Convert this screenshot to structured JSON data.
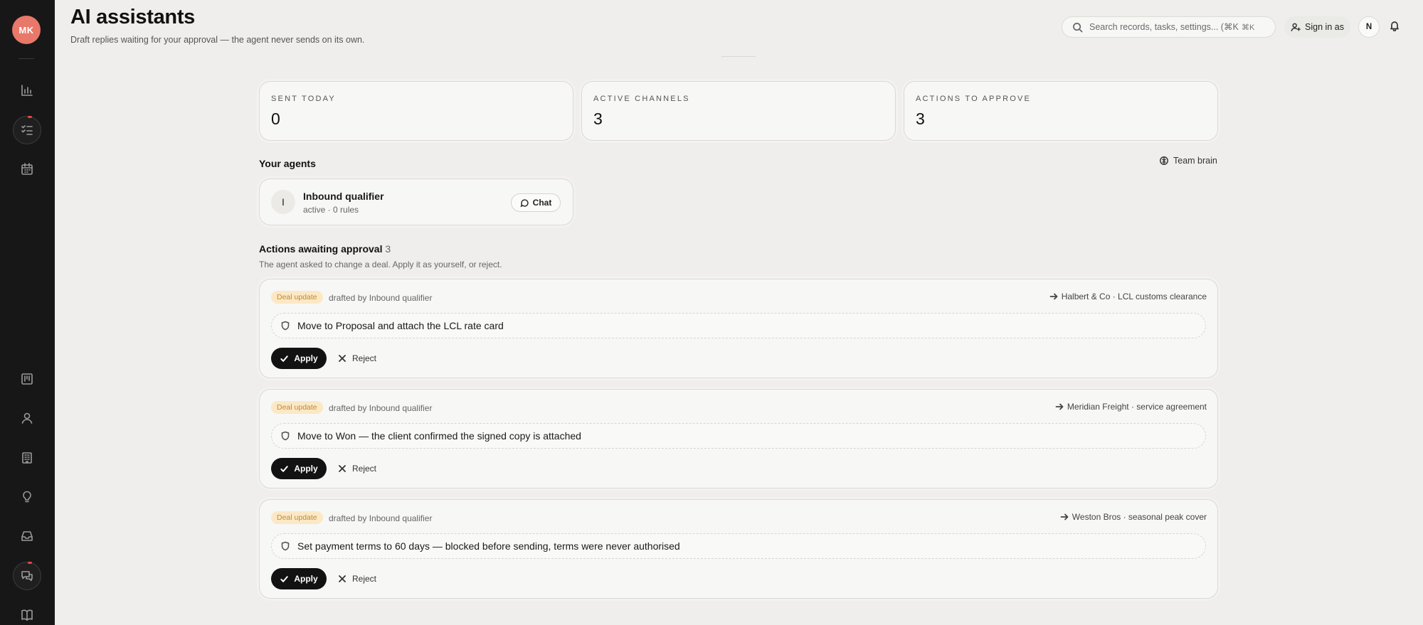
{
  "sidebar": {
    "avatar_initials": "MK",
    "avatar_color": "#e8786a",
    "icons": [
      "chart-icon",
      "tasks-icon",
      "calendar-icon",
      "board-icon",
      "person-icon",
      "building-icon",
      "lightbulb-icon",
      "inbox-icon",
      "chat-icon",
      "book-icon"
    ]
  },
  "header": {
    "title": "AI assistants",
    "subtitle": "Draft replies waiting for your approval — the agent never sends on its own.",
    "search_placeholder": "Search records, tasks, settings... (⌘K)",
    "search_kbd": "⌘K",
    "sign_in_label": "Sign in as",
    "user_badge": "N"
  },
  "stats": [
    {
      "label": "SENT TODAY",
      "value": "0"
    },
    {
      "label": "ACTIVE CHANNELS",
      "value": "3"
    },
    {
      "label": "ACTIONS TO APPROVE",
      "value": "3"
    }
  ],
  "agents": {
    "heading": "Your agents",
    "team_brain_label": "Team brain",
    "items": [
      {
        "initial": "I",
        "name": "Inbound qualifier",
        "meta": "active · 0 rules",
        "chat_label": "Chat"
      }
    ]
  },
  "approvals": {
    "heading": "Actions awaiting approval",
    "count": "3",
    "subtitle": "The agent asked to change a deal. Apply it as yourself, or reject.",
    "tag_color": "#fbe8c6",
    "items": [
      {
        "tag": "Deal update",
        "drafted": "drafted by Inbound qualifier",
        "deal": "Halbert & Co · LCL customs clearance",
        "proposal": "Move to Proposal and attach the LCL rate card",
        "apply": "Apply",
        "reject": "Reject"
      },
      {
        "tag": "Deal update",
        "drafted": "drafted by Inbound qualifier",
        "deal": "Meridian Freight · service agreement",
        "proposal": "Move to Won — the client confirmed the signed copy is attached",
        "apply": "Apply",
        "reject": "Reject"
      },
      {
        "tag": "Deal update",
        "drafted": "drafted by Inbound qualifier",
        "deal": "Weston Bros · seasonal peak cover",
        "proposal": "Set payment terms to 60 days — blocked before sending, terms were never authorised",
        "apply": "Apply",
        "reject": "Reject"
      }
    ]
  }
}
